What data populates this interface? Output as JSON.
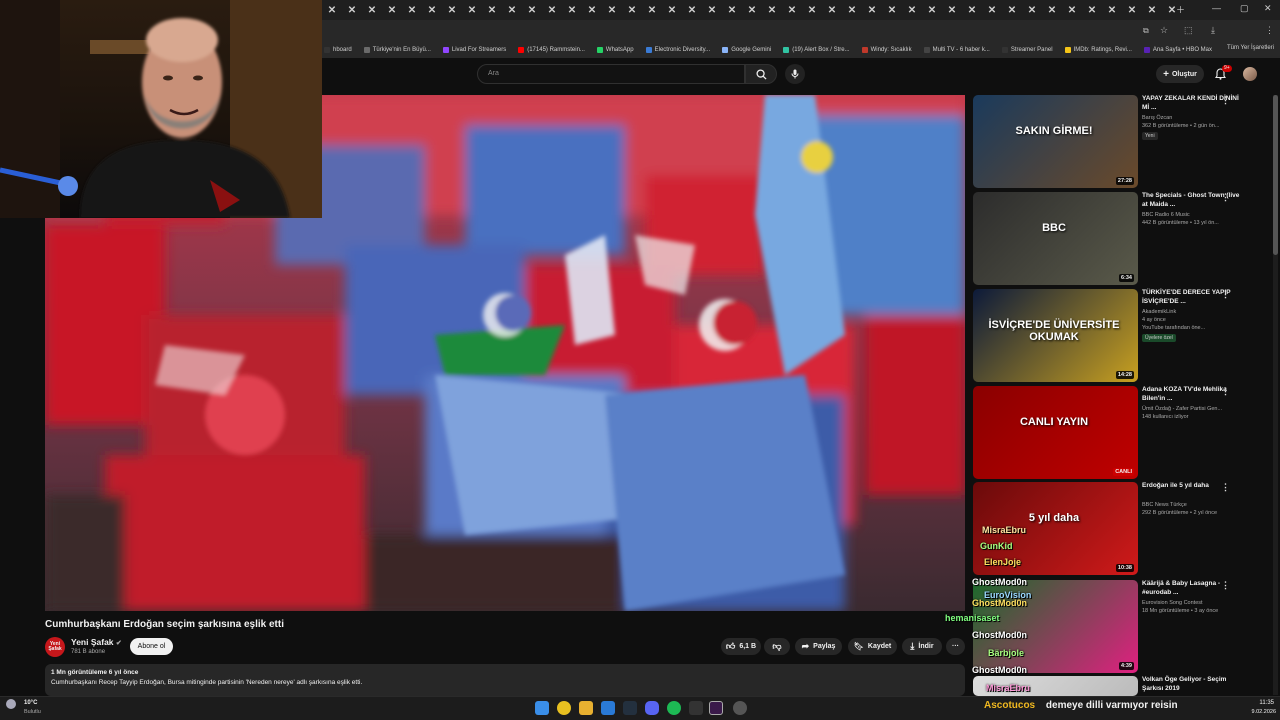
{
  "bookmarks": [
    {
      "label": "hboard",
      "color": "#333"
    },
    {
      "label": "Türkiye'nin En Büyü...",
      "color": "#6a6a6a"
    },
    {
      "label": "Livad For Streamers",
      "color": "#9146ff"
    },
    {
      "label": "(17145) Rammstein...",
      "color": "#ff0000"
    },
    {
      "label": "WhatsApp",
      "color": "#25d366"
    },
    {
      "label": "Electronic Diversity...",
      "color": "#3a7bd5"
    },
    {
      "label": "Google Gemini",
      "color": "#8ab4f8"
    },
    {
      "label": "(19) Alert Box / Stre...",
      "color": "#31c3a2"
    },
    {
      "label": "Windy: Sıcaklık",
      "color": "#c0392b"
    },
    {
      "label": "Multi TV - 6 haber k...",
      "color": "#444"
    },
    {
      "label": "Streamer Panel",
      "color": "#333"
    },
    {
      "label": "IMDb: Ratings, Revi...",
      "color": "#f5c518"
    },
    {
      "label": "Ana Sayfa • HBO Max",
      "color": "#5822b4"
    }
  ],
  "bookmarks_right": "Tüm Yer İşaretleri",
  "search": {
    "placeholder": "Ara"
  },
  "header": {
    "create_label": "Oluştur",
    "notif_count": "9+"
  },
  "video": {
    "title": "Cumhurbaşkanı Erdoğan seçim şarkısına eşlik etti",
    "channel": "Yeni Şafak",
    "channel_avatar": "Yeni Şafak",
    "subscribers": "781 B abone",
    "subscribe_label": "Abone ol",
    "likes": "6,1 B",
    "share_label": "Paylaş",
    "save_label": "Kaydet",
    "download_label": "İndir",
    "more_label": "···",
    "views_line": "1 Mn görüntüleme  6 yıl önce",
    "description": "Cumhurbaşkanı Recep Tayyip Erdoğan, Bursa mitinginde partisinin 'Nereden nereye' adlı şarkısına eşlik etti."
  },
  "recommendations": [
    {
      "title": "YAPAY ZEKALAR KENDİ DİNİNİ Mİ ...",
      "channel": "Barış Özcan",
      "meta": "362 B görüntüleme • 2 gün ön...",
      "badge": "Yeni",
      "duration": "27:28",
      "thumb_text": "SAKIN GİRME!",
      "colors": [
        "#1a3a5c",
        "#6b4a2a"
      ]
    },
    {
      "title": "The Specials - Ghost Town (live at Maida ...",
      "channel": "BBC Radio 6 Music",
      "meta": "442 B görüntüleme • 13 yıl ön...",
      "badge": "",
      "duration": "6:34",
      "thumb_text": "BBC",
      "colors": [
        "#2c2c2c",
        "#5a5a4a"
      ]
    },
    {
      "title": "TÜRKİYE'DE DERECE YAPIP İSVİÇRE'DE ...",
      "channel": "AkademikLink",
      "meta": "4 ay önce",
      "meta2": "YouTube tarafından öne...",
      "badge": "Üyelere özel",
      "duration": "14:28",
      "thumb_text": "İSVİÇRE'DE ÜNİVERSİTE OKUMAK",
      "colors": [
        "#0c1a3a",
        "#c8a020"
      ]
    },
    {
      "title": "Adana KOZA TV'de Mehlika Bilen'in ...",
      "channel": "Ümit Özdağ - Zafer Partisi Gen...",
      "meta": "148 kullanıcı izliyor",
      "badge": "",
      "duration": "CANLI",
      "thumb_text": "CANLI YAYIN",
      "colors": [
        "#8a0000",
        "#c00000"
      ]
    },
    {
      "title": "Erdoğan ile 5 yıl daha",
      "channel": "BBC News Türkçe",
      "meta": "292 B görüntüleme • 2 yıl önce",
      "badge": "",
      "duration": "10:38",
      "thumb_text": "5 yıl daha",
      "colors": [
        "#6a0a0a",
        "#d01a1a"
      ]
    },
    {
      "title": "Käärijä & Baby Lasagna - #eurodab ...",
      "channel": "Eurovision Song Contest",
      "meta": "18 Mn görüntüleme • 3 ay önce",
      "badge": "",
      "duration": "4:39",
      "thumb_text": "",
      "colors": [
        "#1a6a2a",
        "#e02080"
      ]
    },
    {
      "title": "Volkan Öge Geliyor - Seçim Şarkısı 2019",
      "channel": "",
      "meta": "",
      "badge": "",
      "duration": "",
      "thumb_text": "",
      "colors": [
        "#ddd",
        "#bbb"
      ]
    }
  ],
  "chat_overlay": [
    "MisraEbru",
    "GunKid",
    "ElenJoje",
    "GhostMod0n",
    "EuroVision",
    "GhostMod0n",
    "hemanisaset",
    "GhostMod0n",
    "Bärbjole",
    "GhostMod0n",
    "MisraEbru"
  ],
  "weather": {
    "temp": "10°C",
    "condition": "Bulutlu"
  },
  "ticker": {
    "user": "Ascotucos",
    "message": "demeye dilli varmıyor reisin"
  },
  "clock": {
    "time": "11:35",
    "date": "9.02.2026"
  }
}
